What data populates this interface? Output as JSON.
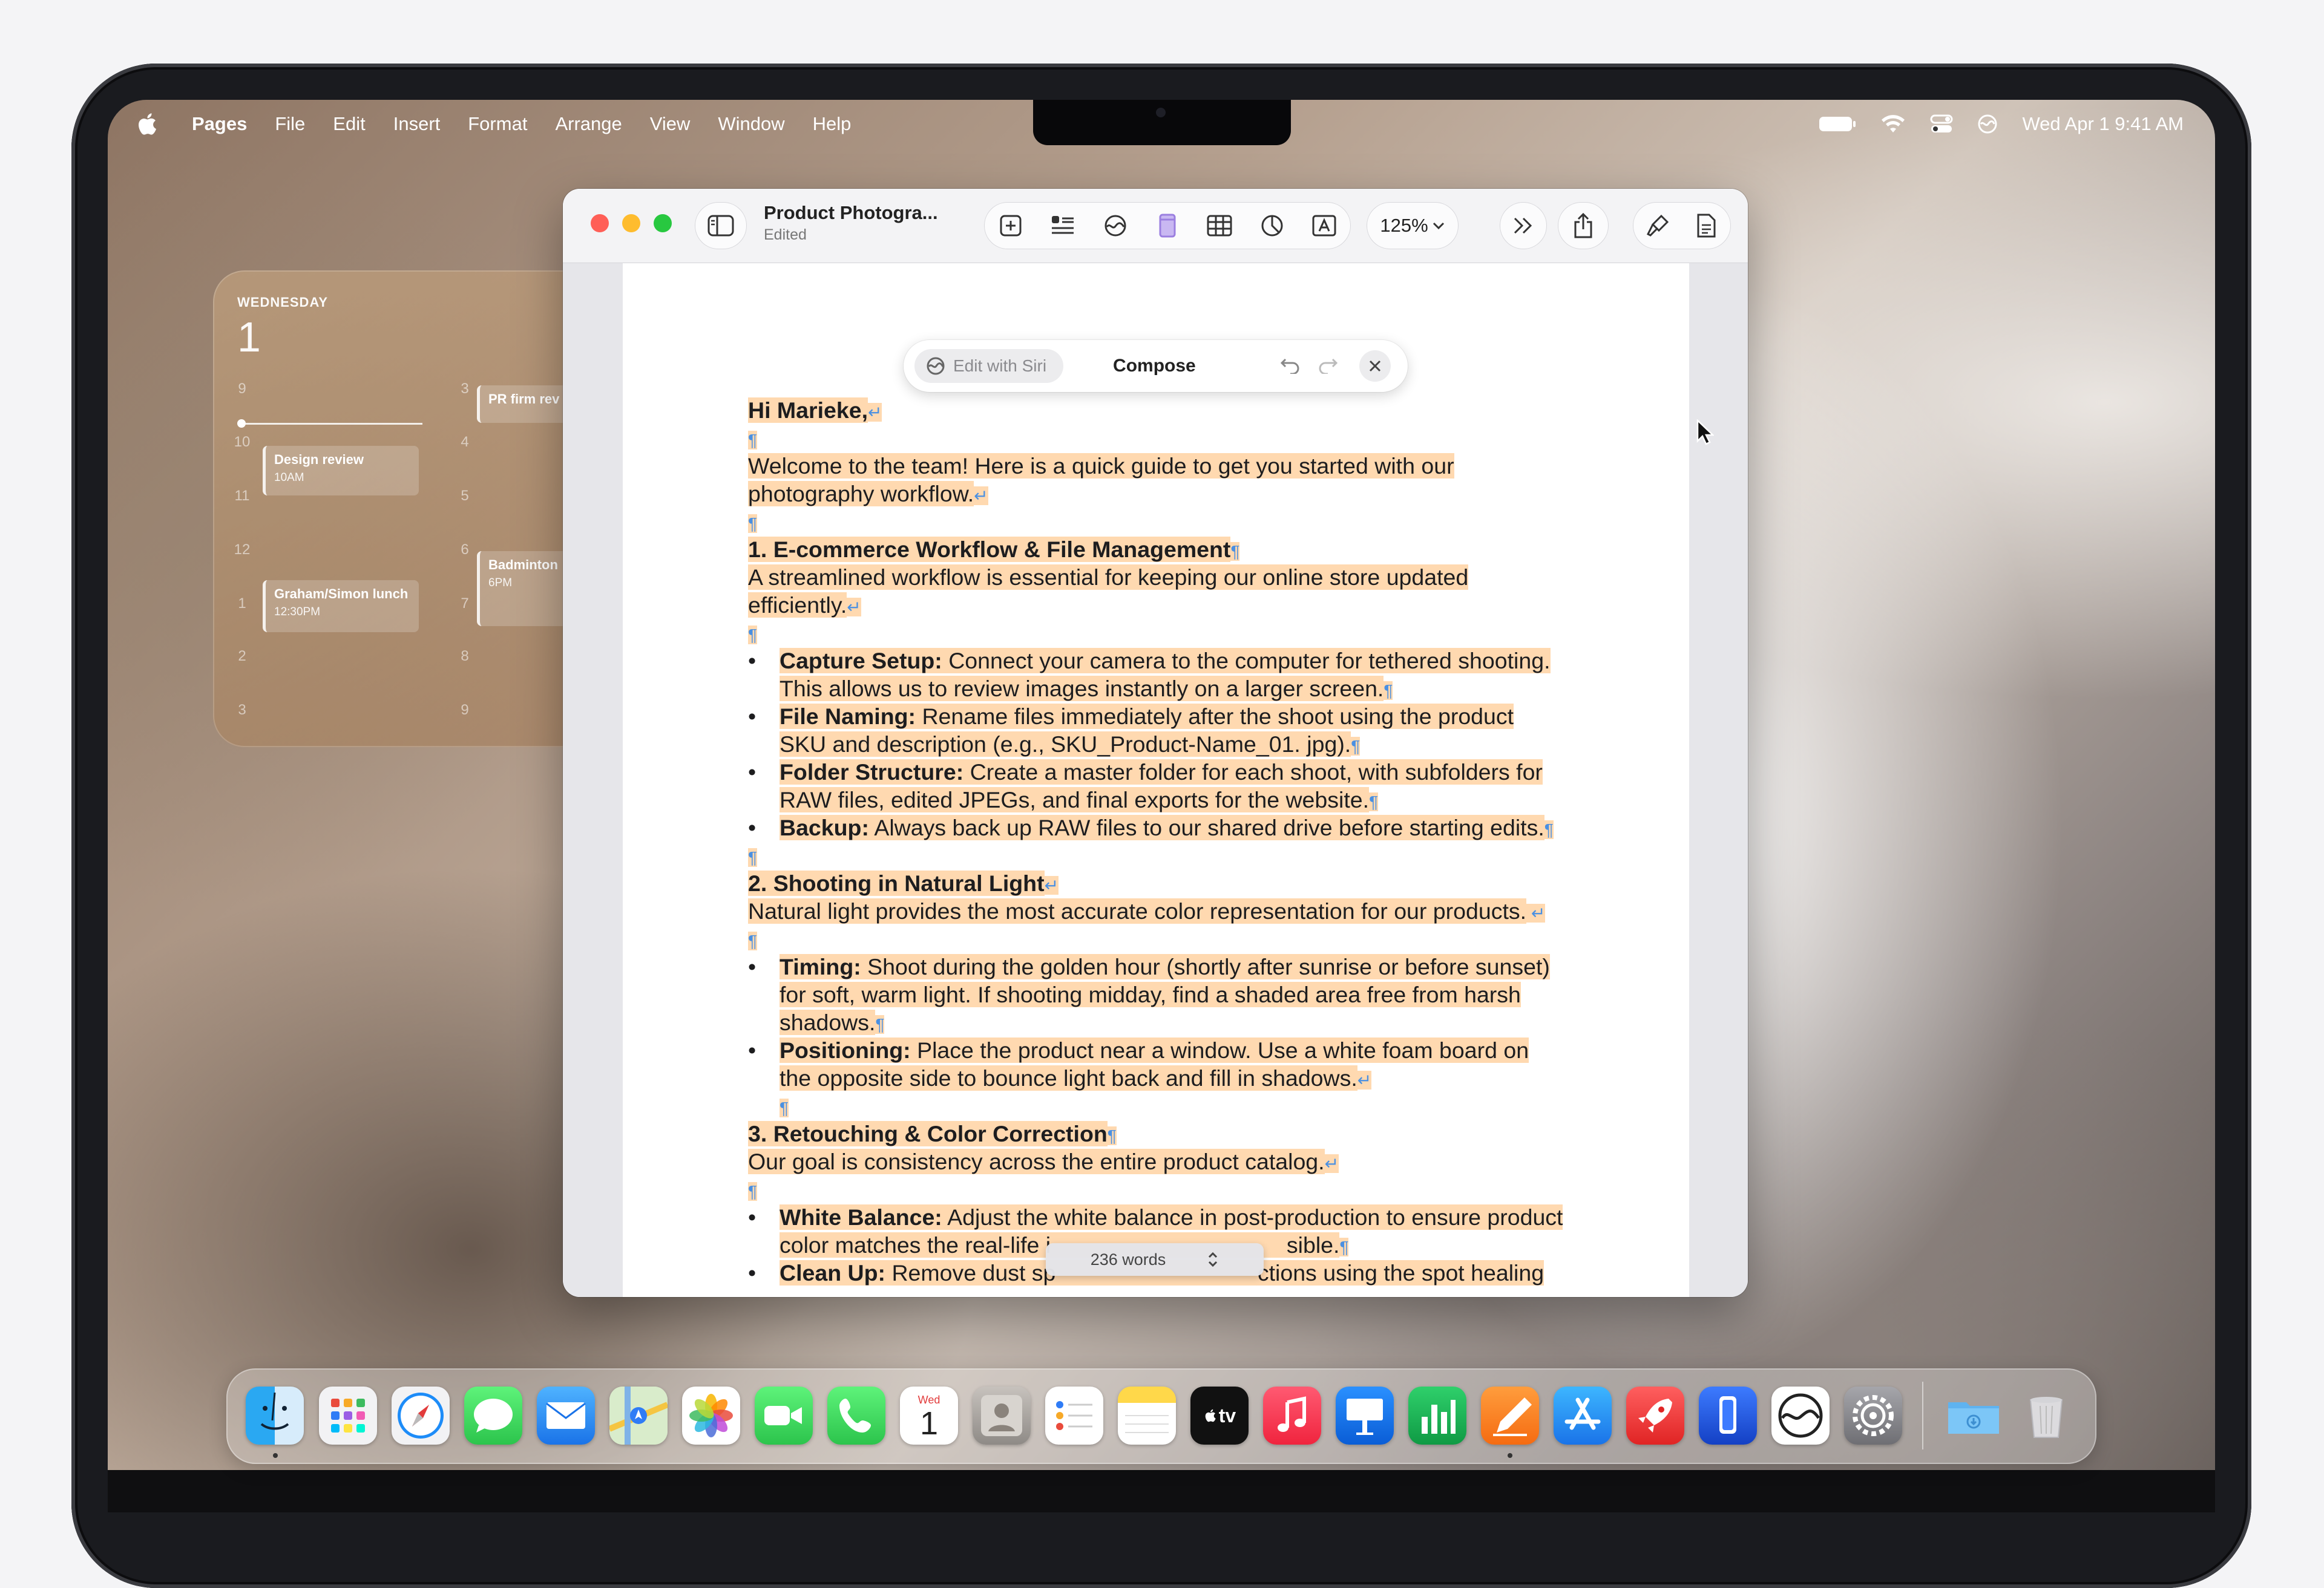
{
  "menubar": {
    "app_name": "Pages",
    "items": [
      "File",
      "Edit",
      "Insert",
      "Format",
      "Arrange",
      "View",
      "Window",
      "Help"
    ],
    "clock": "Wed Apr 1  9:41 AM"
  },
  "calendar_widget": {
    "weekday": "WEDNESDAY",
    "day": "1",
    "left_hours": [
      "9",
      "10",
      "11",
      "12",
      "1",
      "2",
      "3"
    ],
    "right_hours": [
      "3",
      "4",
      "5",
      "6",
      "7",
      "8",
      "9"
    ],
    "events": [
      {
        "title": "Design review",
        "time": "10AM"
      },
      {
        "title": "Graham/Simon lunch",
        "time": "12:30PM"
      },
      {
        "title": "PR firm rev",
        "time": ""
      },
      {
        "title": "Badminton",
        "time": "6PM"
      }
    ]
  },
  "window": {
    "doc_title": "Product Photogra...",
    "doc_status": "Edited",
    "zoom": "125%"
  },
  "siri": {
    "edit_label": "Edit with Siri",
    "compose_label": "Compose"
  },
  "doc": {
    "greeting": "Hi Marieke,",
    "intro_1": "Welcome to the team! Here is a quick guide to get you started with our",
    "intro_2": "photography workflow.",
    "s1_heading": "1. E-commerce Workflow & File Management",
    "s1_text_1": "A streamlined workflow is essential for keeping our online store updated",
    "s1_text_2": "efficiently.",
    "s1_b1_label": "Capture Setup:",
    "s1_b1_text_1": "Connect your camera to the computer for tethered shooting.",
    "s1_b1_text_2": "This allows us to review images instantly on a larger screen.",
    "s1_b2_label": "File Naming:",
    "s1_b2_text_1": "Rename files immediately after the shoot using the product",
    "s1_b2_text_2": "SKU and description (e.g., SKU_Product-Name_01. jpg).",
    "s1_b3_label": "Folder Structure:",
    "s1_b3_text_1": "Create a master folder for each shoot, with subfolders for",
    "s1_b3_text_2": "RAW files, edited JPEGs, and final exports for the website.",
    "s1_b4_label": "Backup:",
    "s1_b4_text_1": "Always back up RAW files to our shared drive before starting edits.",
    "s2_heading": "2. Shooting in Natural Light",
    "s2_text_1": "Natural light provides the most accurate color representation for our products.",
    "s2_b1_label": "Timing:",
    "s2_b1_text_1": "Shoot during the golden hour (shortly after sunrise or before sunset)",
    "s2_b1_text_2": "for soft, warm light. If shooting midday, find a shaded area free from harsh",
    "s2_b1_text_3": "shadows.",
    "s2_b2_label": "Positioning:",
    "s2_b2_text_1": "Place the product near a window. Use a white foam board on",
    "s2_b2_text_2": "the opposite side to bounce light back and fill in shadows.",
    "s3_heading": "3. Retouching & Color Correction",
    "s3_text_1": "Our goal is consistency across the entire product catalog.",
    "s3_b1_label": "White Balance:",
    "s3_b1_text_1": "Adjust the white balance in post-production to ensure product",
    "s3_b1_text_2_a": "color matches the real-life i",
    "s3_b1_text_2_b": "sible.",
    "s3_b2_label": "Clean Up:",
    "s3_b2_text_1_a": "Remove dust sp",
    "s3_b2_text_1_b": "ctions using the spot healing",
    "word_count": "236 words"
  },
  "dock": {
    "calendar_month": "Wed",
    "calendar_day": "1",
    "tv_label": "tv",
    "apps": [
      "finder-icon",
      "launchpad-icon",
      "safari-icon",
      "messages-icon",
      "mail-icon",
      "maps-icon",
      "photos-icon",
      "facetime-icon",
      "phone-icon",
      "calendar-icon",
      "contacts-icon",
      "reminders-icon",
      "notes-icon",
      "tv-icon",
      "music-icon",
      "keynote-icon",
      "numbers-icon",
      "pages-icon",
      "app-store-icon",
      "rocket-icon",
      "iphone-mirroring-icon",
      "siri-icon",
      "system-settings-icon",
      "downloads-folder-icon",
      "trash-icon"
    ]
  },
  "colors": {
    "highlight": "#ffd9b0",
    "paragraph_mark": "#4a90e2",
    "traffic_close": "#ff5f57",
    "traffic_min": "#febc2e",
    "traffic_max": "#28c840"
  }
}
